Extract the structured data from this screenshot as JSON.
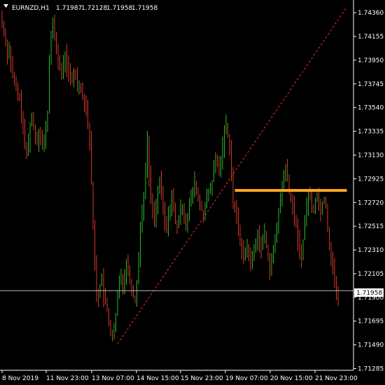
{
  "header": {
    "menu_icon": "triangle-down-icon",
    "symbol": "EURNZD,H1",
    "open": "1.71987",
    "high": "1.72128",
    "low": "1.71958",
    "close": "1.71958"
  },
  "colors": {
    "background": "#000000",
    "bull": "#2db82d",
    "bear": "#d43a2a",
    "trendline": "#ff2a2a",
    "level": "#ffa520",
    "price_line": "#b8b8b8",
    "axis": "#ffffff"
  },
  "current_price": "1.71958",
  "price_axis": {
    "labels": [
      "1.74360",
      "1.74155",
      "1.73950",
      "1.73745",
      "1.73540",
      "1.73335",
      "1.73130",
      "1.72925",
      "1.72720",
      "1.72515",
      "1.72310",
      "1.72105",
      "1.71900",
      "1.71695",
      "1.71490",
      "1.71285"
    ],
    "ylim": [
      1.7127,
      1.7447
    ]
  },
  "time_axis": {
    "labels": [
      "8 Nov 2019",
      "11 Nov 23:00",
      "13 Nov 07:00",
      "14 Nov 15:00",
      "15 Nov 23:00",
      "19 Nov 07:00",
      "20 Nov 15:00",
      "21 Nov 23:00"
    ]
  },
  "chart_data": {
    "type": "ohlc",
    "symbol": "EURNZD",
    "timeframe": "H1",
    "series": [
      {
        "name": "EURNZD",
        "closes": [
          1.7428,
          1.7418,
          1.7412,
          1.74,
          1.7405,
          1.7392,
          1.738,
          1.7375,
          1.737,
          1.7365,
          1.736,
          1.735,
          1.7335,
          1.732,
          1.7315,
          1.7325,
          1.734,
          1.7345,
          1.7338,
          1.733,
          1.7325,
          1.7335,
          1.733,
          1.732,
          1.7325,
          1.7335,
          1.735,
          1.7395,
          1.742,
          1.7425,
          1.7415,
          1.7405,
          1.7395,
          1.739,
          1.738,
          1.7392,
          1.74,
          1.739,
          1.7385,
          1.738,
          1.7375,
          1.7385,
          1.7382,
          1.7375,
          1.7375,
          1.737,
          1.7365,
          1.736,
          1.7355,
          1.734,
          1.7325,
          1.729,
          1.725,
          1.722,
          1.7195,
          1.719,
          1.72,
          1.721,
          1.719,
          1.7185,
          1.7178,
          1.717,
          1.716,
          1.7155,
          1.716,
          1.7175,
          1.719,
          1.7205,
          1.721,
          1.72,
          1.721,
          1.722,
          1.7215,
          1.7205,
          1.72,
          1.719,
          1.7188,
          1.7205,
          1.7225,
          1.725,
          1.7265,
          1.728,
          1.73,
          1.7325,
          1.7295,
          1.7275,
          1.7265,
          1.726,
          1.727,
          1.728,
          1.729,
          1.728,
          1.7265,
          1.7255,
          1.725,
          1.726,
          1.727,
          1.7278,
          1.7265,
          1.7255,
          1.725,
          1.7258,
          1.7265,
          1.727,
          1.726,
          1.7255,
          1.726,
          1.727,
          1.7275,
          1.7282,
          1.729,
          1.728,
          1.7275,
          1.727,
          1.7265,
          1.7262,
          1.7268,
          1.7275,
          1.728,
          1.7285,
          1.729,
          1.73,
          1.731,
          1.7305,
          1.73,
          1.731,
          1.732,
          1.7335,
          1.734,
          1.733,
          1.732,
          1.73,
          1.727,
          1.7265,
          1.726,
          1.725,
          1.724,
          1.723,
          1.7225,
          1.723,
          1.7235,
          1.7225,
          1.722,
          1.7225,
          1.723,
          1.724,
          1.7245,
          1.7238,
          1.7232,
          1.724,
          1.7245,
          1.7235,
          1.7225,
          1.7215,
          1.722,
          1.723,
          1.724,
          1.725,
          1.7265,
          1.7275,
          1.7285,
          1.7295,
          1.7305,
          1.729,
          1.728,
          1.7275,
          1.7268,
          1.726,
          1.725,
          1.724,
          1.723,
          1.7225,
          1.724,
          1.7255,
          1.727,
          1.728,
          1.7275,
          1.727,
          1.7265,
          1.7275,
          1.728,
          1.727,
          1.7265,
          1.7272,
          1.7276,
          1.727,
          1.725,
          1.7235,
          1.7225,
          1.7215,
          1.7205,
          1.7195,
          1.7185
        ]
      }
    ],
    "annotations": {
      "trendline": {
        "from": {
          "bar": 66,
          "price": 1.715
        },
        "to": {
          "bar": 197,
          "price": 1.7441
        }
      },
      "horizontal_level": {
        "from_bar": 133,
        "to_bar": 197,
        "price": 1.72825
      },
      "current_price_line": 1.71958
    }
  }
}
